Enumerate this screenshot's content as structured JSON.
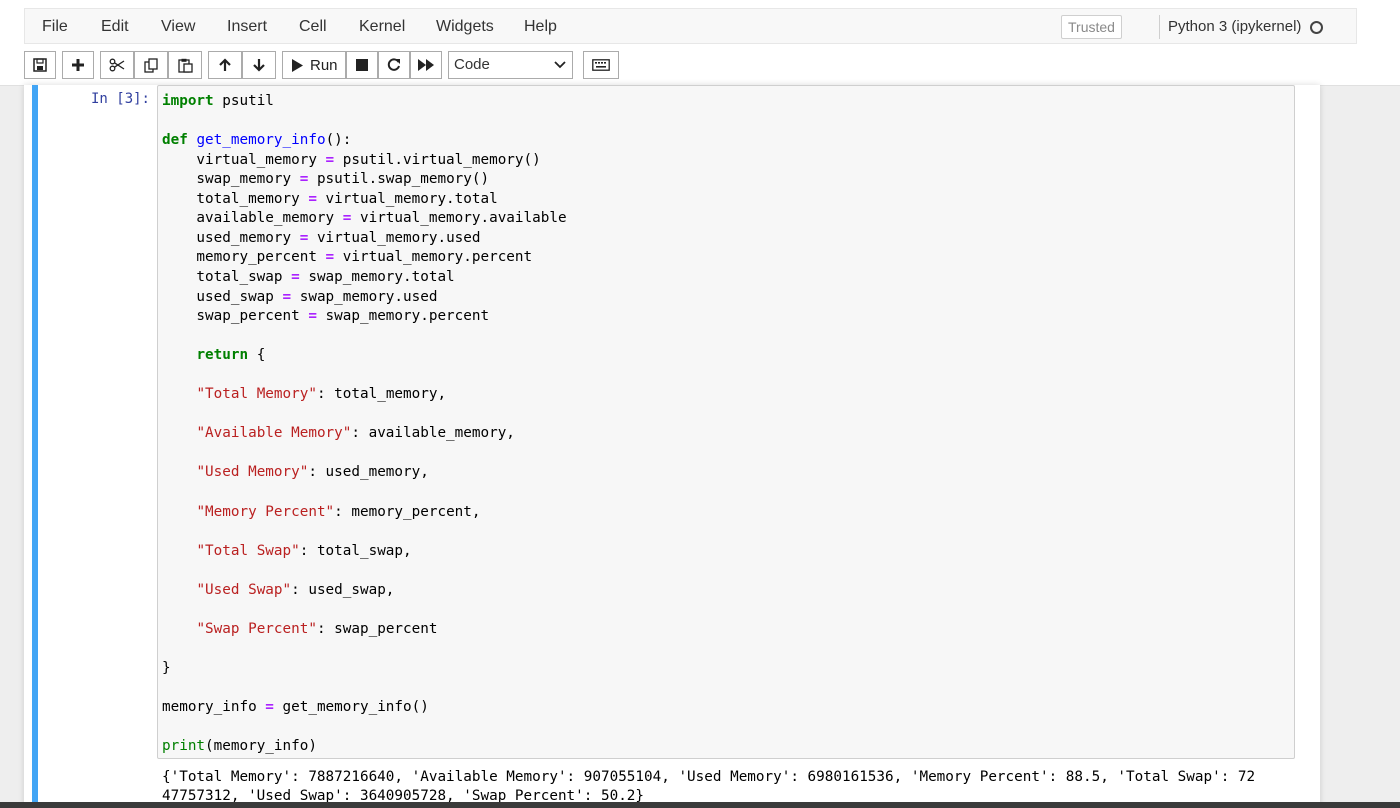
{
  "menu": [
    "File",
    "Edit",
    "View",
    "Insert",
    "Cell",
    "Kernel",
    "Widgets",
    "Help"
  ],
  "status": {
    "trusted": "Trusted",
    "kernel": "Python 3 (ipykernel)"
  },
  "toolbar": {
    "run_label": "Run",
    "cell_type": "Code",
    "icons": [
      "save-icon",
      "add-icon",
      "cut-icon",
      "copy-icon",
      "paste-icon",
      "move-up-icon",
      "move-down-icon",
      "run-icon",
      "stop-icon",
      "restart-icon",
      "fast-forward-icon",
      "keyboard-icon"
    ]
  },
  "cell": {
    "prompt": "In [3]:",
    "code_lines": [
      "import psutil",
      "",
      "def get_memory_info():",
      "    virtual_memory = psutil.virtual_memory()",
      "    swap_memory = psutil.swap_memory()",
      "    total_memory = virtual_memory.total",
      "    available_memory = virtual_memory.available",
      "    used_memory = virtual_memory.used",
      "    memory_percent = virtual_memory.percent",
      "    total_swap = swap_memory.total",
      "    used_swap = swap_memory.used",
      "    swap_percent = swap_memory.percent",
      "",
      "    return {",
      "",
      "    \"Total Memory\": total_memory,",
      "",
      "    \"Available Memory\": available_memory,",
      "",
      "    \"Used Memory\": used_memory,",
      "",
      "    \"Memory Percent\": memory_percent,",
      "",
      "    \"Total Swap\": total_swap,",
      "",
      "    \"Used Swap\": used_swap,",
      "",
      "    \"Swap Percent\": swap_percent",
      "",
      "}",
      "",
      "memory_info = get_memory_info()",
      "",
      "print(memory_info)"
    ],
    "output_lines": [
      "{'Total Memory': 7887216640, 'Available Memory': 907055104, 'Used Memory': 6980161536, 'Memory Percent': 88.5, 'Total Swap': 72",
      "47757312, 'Used Swap': 3640905728, 'Swap Percent': 50.2}"
    ]
  },
  "colors": {
    "keyword": "#008000",
    "function": "#0000ff",
    "operator": "#aa22ff",
    "string": "#ba2121",
    "prompt": "#303f9f",
    "selected_bar": "#42a5f5"
  }
}
